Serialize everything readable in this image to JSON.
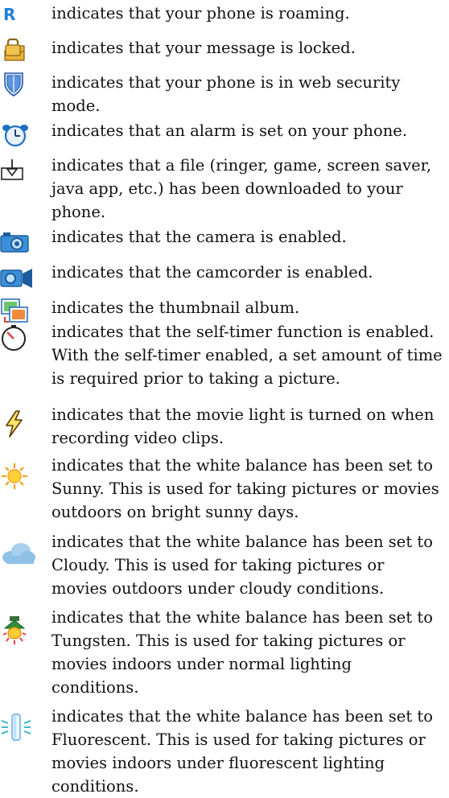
{
  "items": [
    {
      "icon": "roaming-r-icon",
      "glyph": "R",
      "lines": [
        "indicates that your phone is roaming."
      ]
    },
    {
      "icon": "lock-message-icon",
      "lines": [
        "indicates that your message is locked."
      ]
    },
    {
      "icon": "shield-icon",
      "lines": [
        "indicates that your phone is in web security",
        "mode."
      ]
    },
    {
      "icon": "alarm-clock-icon",
      "lines": [
        "indicates that an alarm is set on your phone."
      ]
    },
    {
      "icon": "download-arrow-icon",
      "lines": [
        "indicates that a file (ringer, game, screen saver,",
        "java app, etc.) has been downloaded to your",
        "phone."
      ]
    },
    {
      "icon": "camera-icon",
      "lines": [
        "indicates that the camera is enabled."
      ]
    },
    {
      "icon": "camcorder-icon",
      "lines": [
        "indicates that the camcorder is enabled."
      ]
    },
    {
      "icon": "thumbnail-album-icon",
      "lines": [
        "indicates the thumbnail album."
      ]
    },
    {
      "icon": "self-timer-icon",
      "lines": [
        "indicates that the self-timer function is enabled.",
        "With the self-timer enabled, a set amount of time",
        "is required prior to taking a picture."
      ]
    },
    {
      "icon": "lightning-icon",
      "lines": [
        "indicates that the movie light is turned on when",
        "recording video clips."
      ]
    },
    {
      "icon": "sun-icon",
      "lines": [
        "indicates that the white balance has been set to",
        "Sunny. This is used for taking pictures or movies",
        "outdoors on bright sunny days."
      ]
    },
    {
      "icon": "cloud-icon",
      "lines": [
        "indicates that the white balance has been set to",
        "Cloudy. This is used for taking pictures or",
        "movies outdoors under cloudy conditions."
      ]
    },
    {
      "icon": "tungsten-bulb-icon",
      "lines": [
        "indicates that the white balance has been set to",
        "Tungsten. This is used for taking pictures or",
        "movies indoors under normal lighting",
        "conditions."
      ]
    },
    {
      "icon": "fluorescent-tube-icon",
      "lines": [
        "indicates that the white balance has been set to",
        "Fluorescent. This is used for taking pictures or",
        "movies indoors under fluorescent lighting",
        "conditions."
      ]
    }
  ]
}
